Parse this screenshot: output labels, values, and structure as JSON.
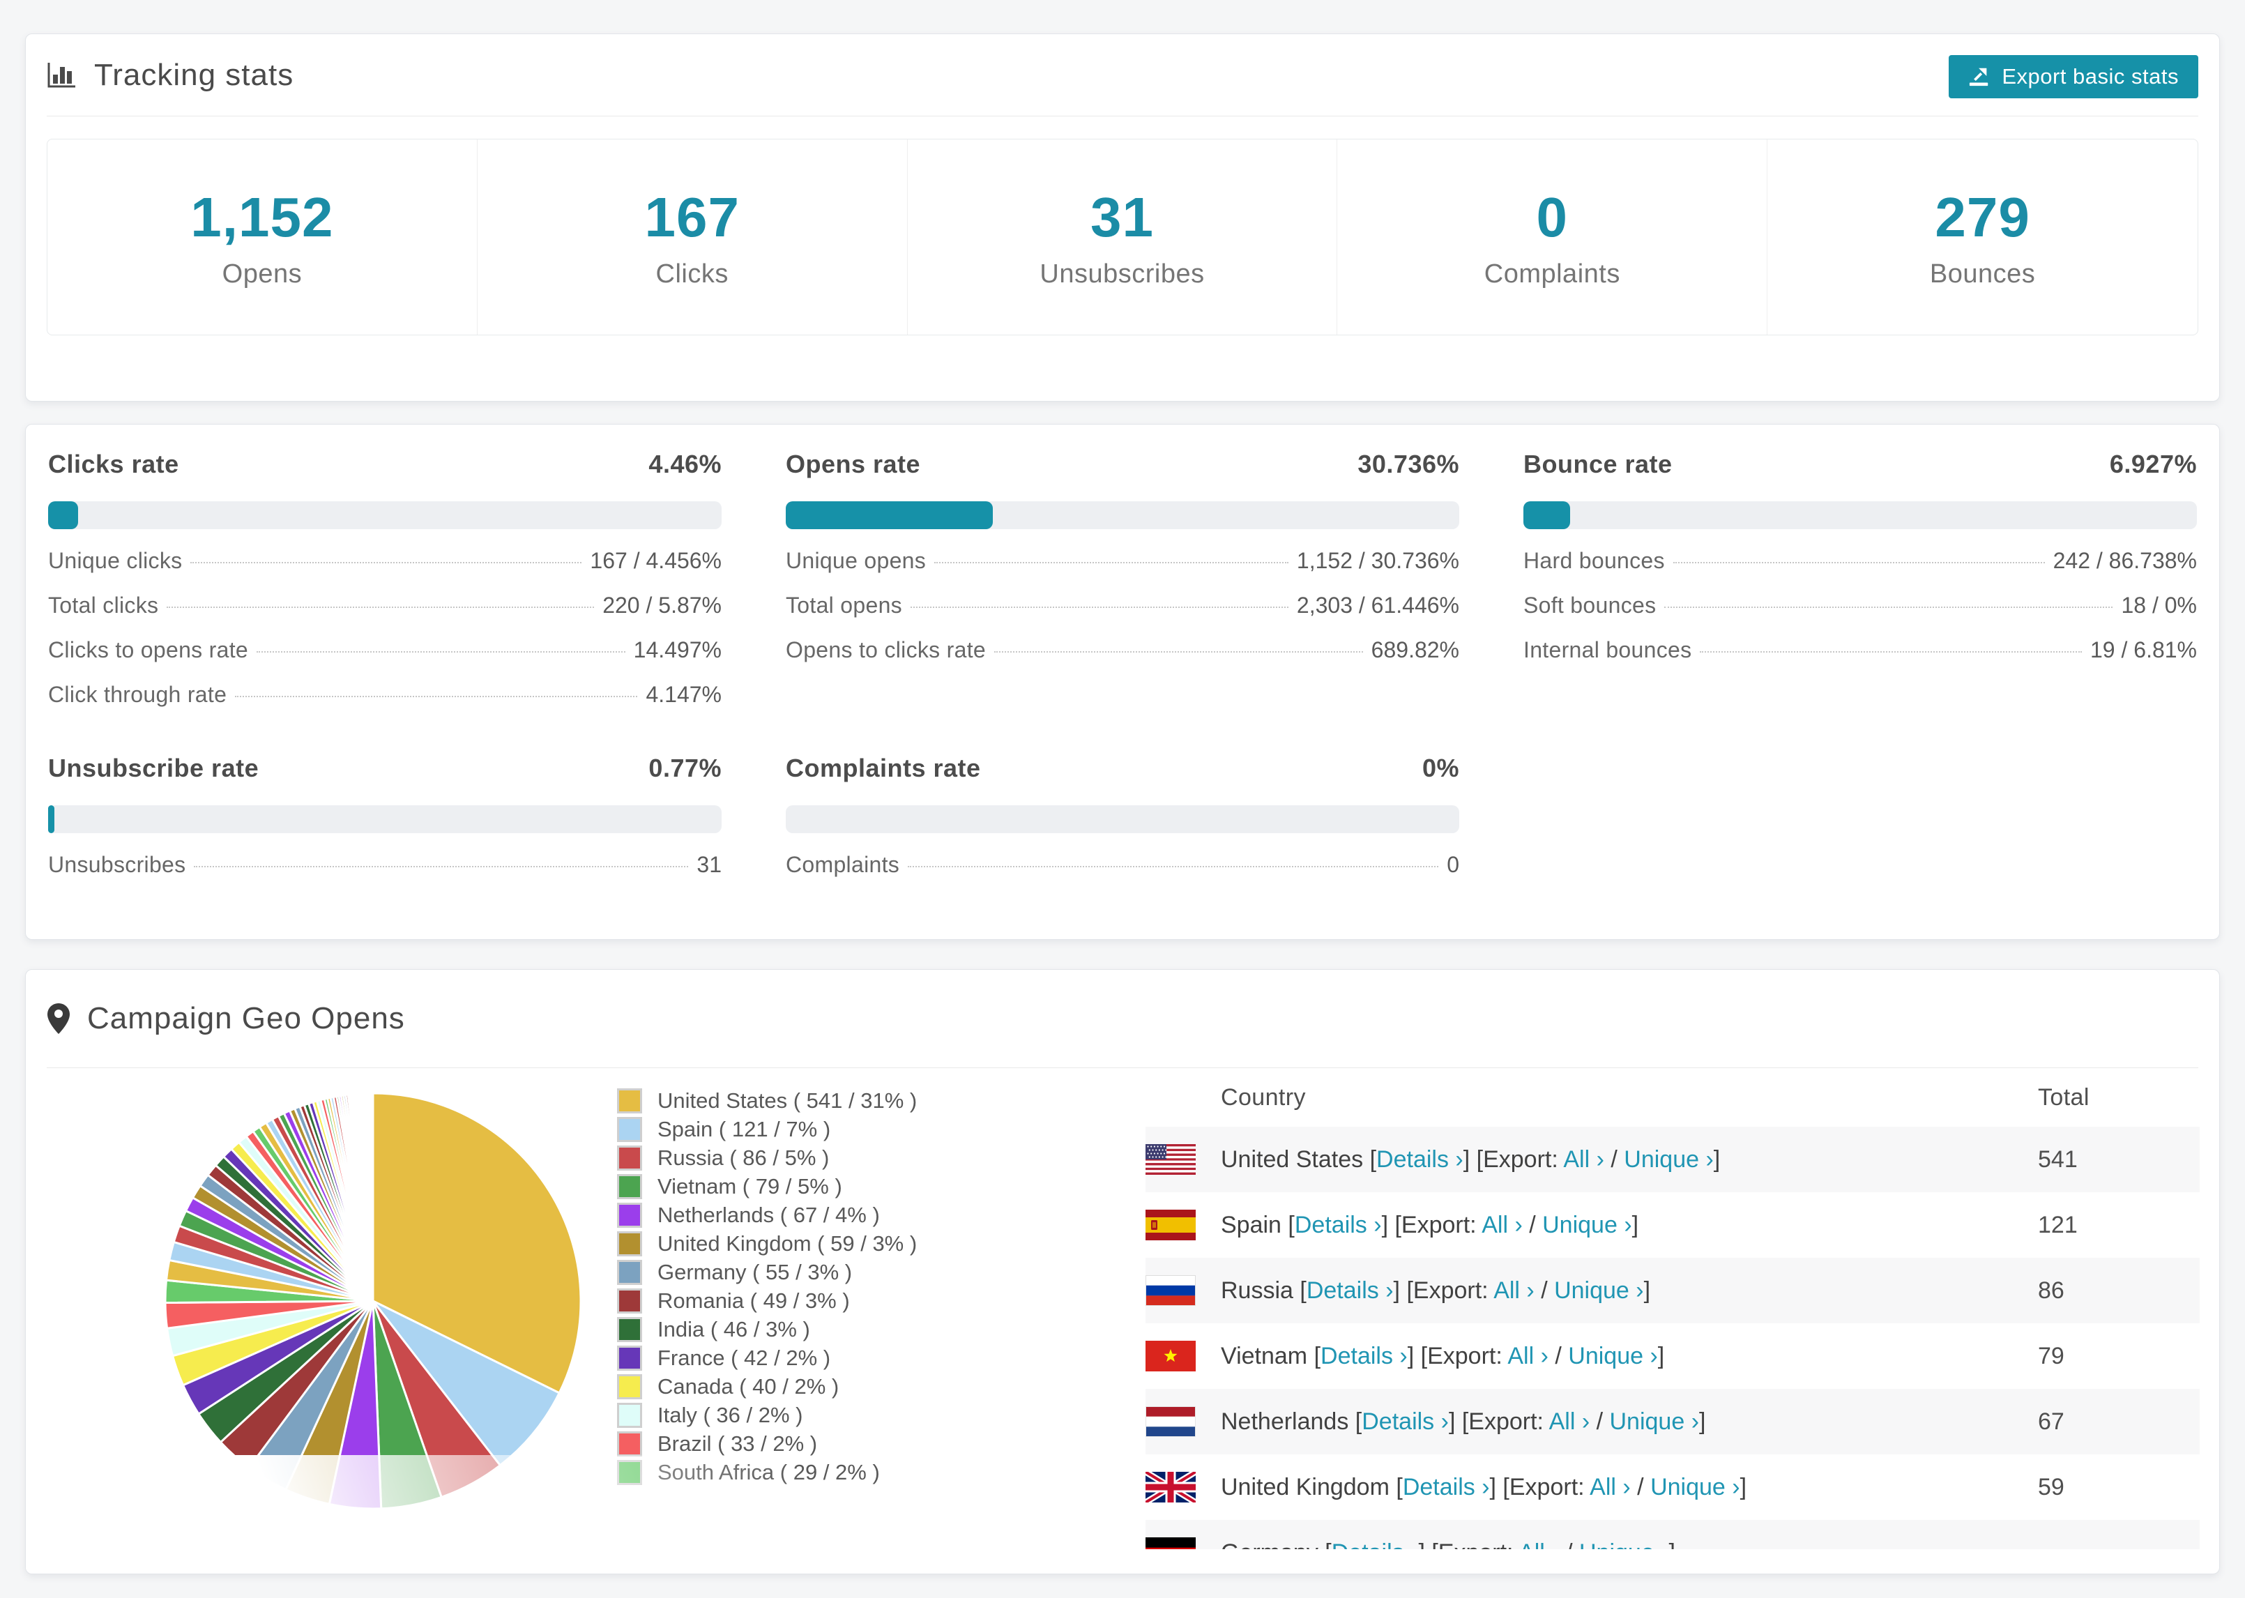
{
  "accent": "#1691a8",
  "header": {
    "title": "Tracking stats",
    "export_label": "Export basic stats"
  },
  "summary_stats": [
    {
      "value": "1,152",
      "label": "Opens"
    },
    {
      "value": "167",
      "label": "Clicks"
    },
    {
      "value": "31",
      "label": "Unsubscribes"
    },
    {
      "value": "0",
      "label": "Complaints"
    },
    {
      "value": "279",
      "label": "Bounces"
    }
  ],
  "rate_blocks": [
    {
      "title": "Clicks rate",
      "value": "4.46%",
      "percent": 4.46,
      "rows": [
        {
          "label": "Unique clicks",
          "value": "167 / 4.456%"
        },
        {
          "label": "Total clicks",
          "value": "220 / 5.87%"
        },
        {
          "label": "Clicks to opens rate",
          "value": "14.497%"
        },
        {
          "label": "Click through rate",
          "value": "4.147%"
        }
      ]
    },
    {
      "title": "Opens rate",
      "value": "30.736%",
      "percent": 30.736,
      "rows": [
        {
          "label": "Unique opens",
          "value": "1,152 / 30.736%"
        },
        {
          "label": "Total opens",
          "value": "2,303 / 61.446%"
        },
        {
          "label": "Opens to clicks rate",
          "value": "689.82%"
        }
      ]
    },
    {
      "title": "Bounce rate",
      "value": "6.927%",
      "percent": 6.927,
      "rows": [
        {
          "label": "Hard bounces",
          "value": "242 / 86.738%"
        },
        {
          "label": "Soft bounces",
          "value": "18 / 0%"
        },
        {
          "label": "Internal bounces",
          "value": "19 / 6.81%"
        }
      ]
    },
    {
      "title": "Unsubscribe rate",
      "value": "0.77%",
      "percent": 0.77,
      "rows": [
        {
          "label": "Unsubscribes",
          "value": "31"
        }
      ]
    },
    {
      "title": "Complaints rate",
      "value": "0%",
      "percent": 0,
      "rows": [
        {
          "label": "Complaints",
          "value": "0"
        }
      ]
    }
  ],
  "geo": {
    "title": "Campaign Geo Opens",
    "legend": [
      {
        "label": "United States ( 541 / 31% )",
        "color": "#e5bd43"
      },
      {
        "label": "Spain ( 121 / 7% )",
        "color": "#abd4f2"
      },
      {
        "label": "Russia ( 86 / 5% )",
        "color": "#c94a4c"
      },
      {
        "label": "Vietnam ( 79 / 5% )",
        "color": "#4ca450"
      },
      {
        "label": "Netherlands ( 67 / 4% )",
        "color": "#9b3eeb"
      },
      {
        "label": "United Kingdom ( 59 / 3% )",
        "color": "#b2902f"
      },
      {
        "label": "Germany ( 55 / 3% )",
        "color": "#7ca2c0"
      },
      {
        "label": "Romania ( 49 / 3% )",
        "color": "#9e3939"
      },
      {
        "label": "India ( 46 / 3% )",
        "color": "#2f7038"
      },
      {
        "label": "France ( 42 / 2% )",
        "color": "#6637b8"
      },
      {
        "label": "Canada ( 40 / 2% )",
        "color": "#f6ec4e"
      },
      {
        "label": "Italy ( 36 / 2% )",
        "color": "#dffdf9"
      },
      {
        "label": "Brazil ( 33 / 2% )",
        "color": "#f55f61"
      },
      {
        "label": "South Africa ( 29 / 2% )",
        "color": "#67cb6b"
      }
    ],
    "table": {
      "country_header": "Country",
      "total_header": "Total",
      "link_details": "Details ›",
      "export_prefix": "Export:",
      "link_all": "All ›",
      "link_unique": "Unique ›",
      "rows": [
        {
          "flag": "us",
          "country": "United States",
          "total": "541"
        },
        {
          "flag": "es",
          "country": "Spain",
          "total": "121"
        },
        {
          "flag": "ru",
          "country": "Russia",
          "total": "86"
        },
        {
          "flag": "vn",
          "country": "Vietnam",
          "total": "79"
        },
        {
          "flag": "nl",
          "country": "Netherlands",
          "total": "67"
        },
        {
          "flag": "gb",
          "country": "United Kingdom",
          "total": "59"
        },
        {
          "flag": "de",
          "country": "Germany",
          "total": ""
        }
      ]
    }
  },
  "chart_data": {
    "type": "pie",
    "title": "Campaign Geo Opens",
    "legend_position": "right",
    "start_angle_deg": -90,
    "direction": "clockwise",
    "labels": [
      "United States",
      "Spain",
      "Russia",
      "Vietnam",
      "Netherlands",
      "United Kingdom",
      "Germany",
      "Romania",
      "India",
      "France",
      "Canada",
      "Italy",
      "Brazil",
      "South Africa"
    ],
    "values": [
      541,
      121,
      86,
      79,
      67,
      59,
      55,
      49,
      46,
      42,
      40,
      36,
      33,
      29
    ],
    "percent_labels": [
      "31%",
      "7%",
      "5%",
      "5%",
      "4%",
      "3%",
      "3%",
      "3%",
      "3%",
      "2%",
      "2%",
      "2%",
      "2%",
      "2%"
    ],
    "colors": [
      "#e5bd43",
      "#abd4f2",
      "#c94a4c",
      "#4ca450",
      "#9b3eeb",
      "#b2902f",
      "#7ca2c0",
      "#9e3939",
      "#2f7038",
      "#6637b8",
      "#f6ec4e",
      "#dffdf9",
      "#f55f61",
      "#67cb6b"
    ],
    "others_values": [
      26,
      24,
      22,
      21,
      19,
      18,
      17,
      16,
      15,
      14,
      13,
      12,
      11,
      10,
      10,
      9,
      9,
      8,
      8,
      7,
      7,
      6,
      6,
      6,
      5,
      5,
      5,
      4,
      4,
      4,
      4,
      3,
      3,
      3,
      3,
      3,
      2,
      2,
      2,
      2,
      2,
      2,
      2,
      2,
      1,
      1,
      1,
      1,
      1,
      1,
      1,
      1,
      1,
      1,
      1,
      1,
      1,
      1,
      1,
      1
    ]
  }
}
